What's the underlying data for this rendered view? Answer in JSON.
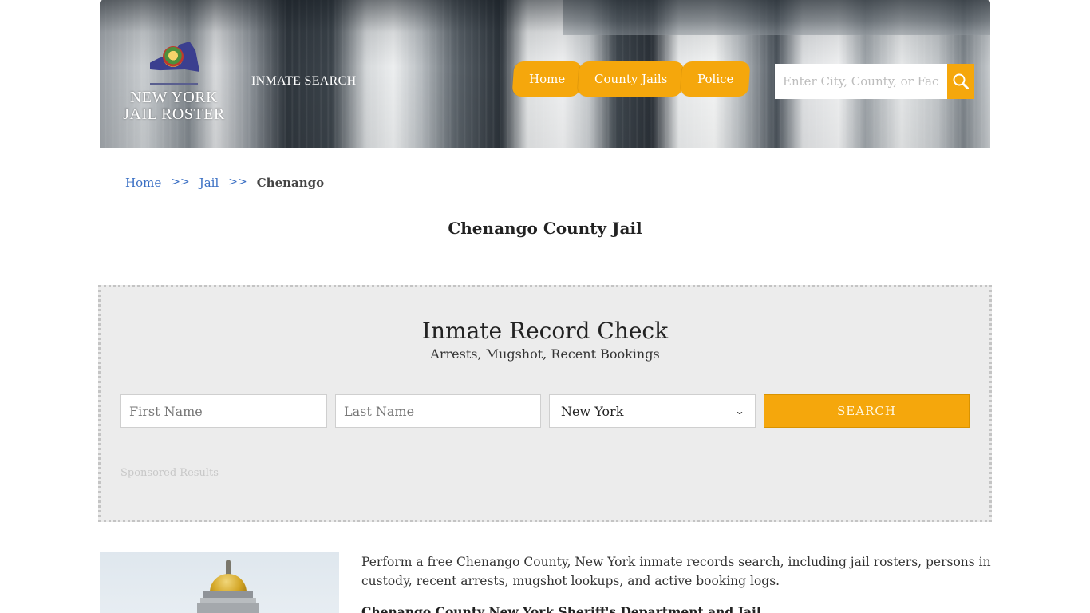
{
  "header": {
    "logo_text_line1": "NEW YORK",
    "logo_text_line2": "JAIL ROSTER",
    "inmate_search_link": "INMATE SEARCH",
    "nav": [
      {
        "label": "Home"
      },
      {
        "label": "County Jails"
      },
      {
        "label": "Police"
      }
    ],
    "search": {
      "placeholder": "Enter City, County, or Facility",
      "value": "",
      "icon": "search-icon"
    },
    "accent_color": "#f5a70c"
  },
  "breadcrumb": {
    "items": [
      {
        "label": "Home"
      },
      {
        "label": "Jail"
      }
    ],
    "separator": ">>",
    "current": "Chenango"
  },
  "page": {
    "title": "Chenango County Jail"
  },
  "record_check": {
    "title": "Inmate Record Check",
    "subtitle": "Arrests, Mugshot, Recent Bookings",
    "first_name_placeholder": "First Name",
    "last_name_placeholder": "Last Name",
    "state_selected": "New York",
    "search_button": "SEARCH",
    "sponsored_label": "Sponsored Results"
  },
  "content": {
    "intro": "Perform a free Chenango County, New York inmate records search, including jail rosters, persons in custody, recent arrests, mugshot lookups, and active booking logs.",
    "subheading": "Chenango County New York Sheriff's Department and Jail",
    "image_alt": "courthouse-dome-image"
  }
}
